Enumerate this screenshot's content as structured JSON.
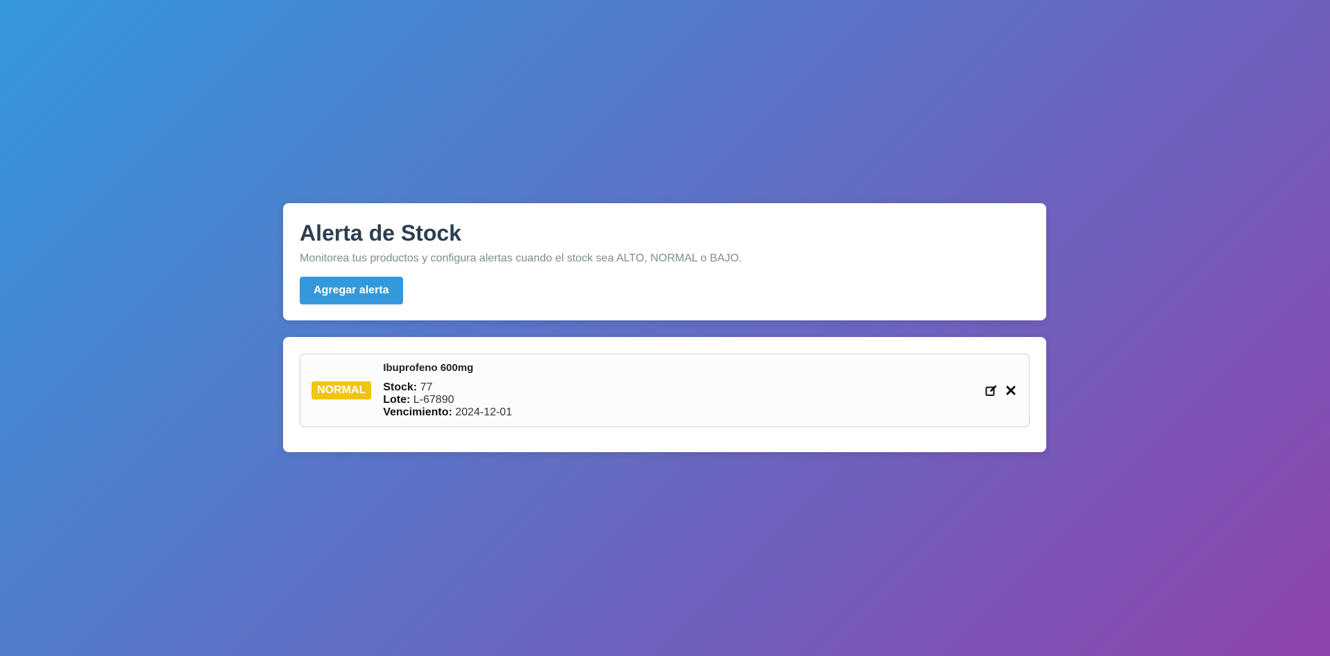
{
  "header": {
    "title": "Alerta de Stock",
    "subtitle": "Monitorea tus productos y configura alertas cuando el stock sea ALTO, NORMAL o BAJO.",
    "add_button_label": "Agregar alerta"
  },
  "alerts": [
    {
      "status": "NORMAL",
      "status_color": "#f1c40f",
      "product": "Ibuprofeno 600mg",
      "stock_label": "Stock:",
      "stock_value": "77",
      "lote_label": "Lote:",
      "lote_value": "L-67890",
      "vencimiento_label": "Vencimiento:",
      "vencimiento_value": "2024-12-01",
      "actions": {
        "edit_icon": "edit-icon",
        "delete_icon": "close-icon"
      }
    }
  ],
  "colors": {
    "accent": "#3498db",
    "gradient_start": "#3498db",
    "gradient_end": "#8e44ad"
  }
}
